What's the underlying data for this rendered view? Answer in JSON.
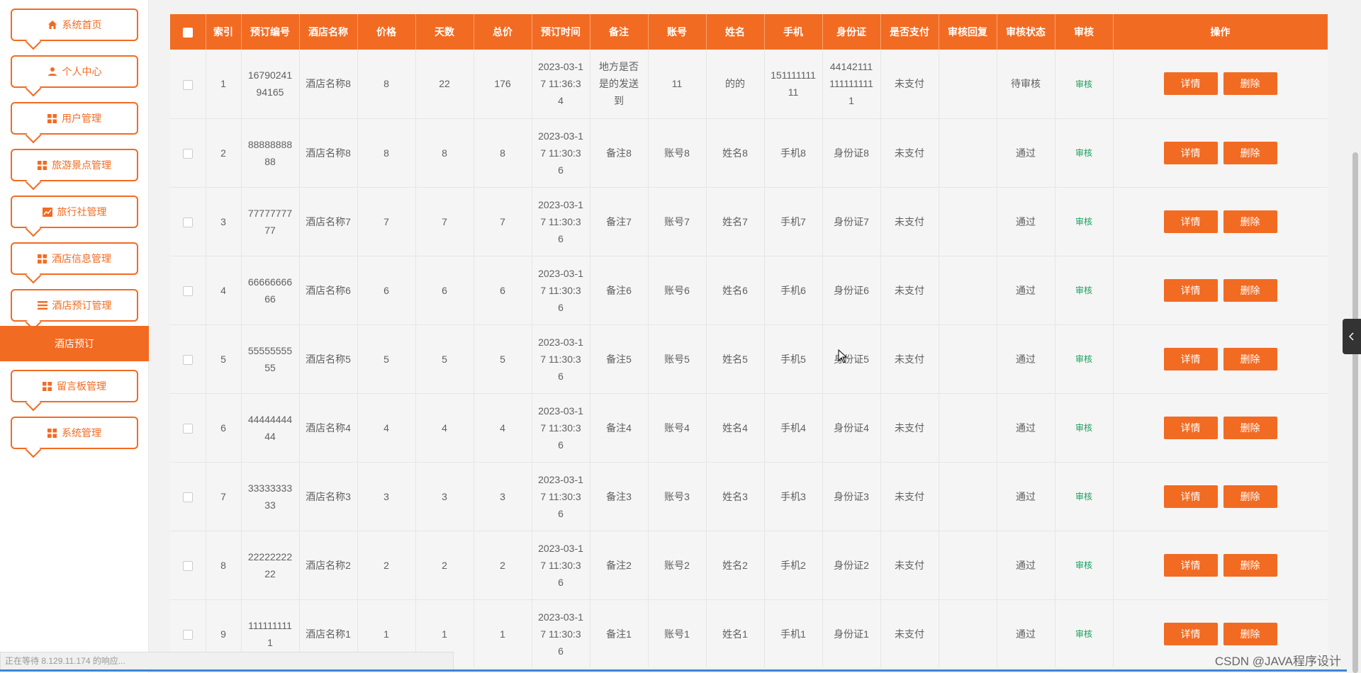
{
  "sidebar": {
    "items": [
      {
        "label": "系统首页",
        "icon": "home-icon"
      },
      {
        "label": "个人中心",
        "icon": "user-icon"
      },
      {
        "label": "用户管理",
        "icon": "grid-icon"
      },
      {
        "label": "旅游景点管理",
        "icon": "grid-icon"
      },
      {
        "label": "旅行社管理",
        "icon": "chart-icon"
      },
      {
        "label": "酒店信息管理",
        "icon": "grid-icon"
      },
      {
        "label": "酒店预订管理",
        "icon": "list-icon"
      },
      {
        "label": "留言板管理",
        "icon": "grid-icon"
      },
      {
        "label": "系统管理",
        "icon": "grid-icon"
      }
    ],
    "active_sub": "酒店预订"
  },
  "table": {
    "headers": [
      "",
      "索引",
      "预订编号",
      "酒店名称",
      "价格",
      "天数",
      "总价",
      "预订时间",
      "备注",
      "账号",
      "姓名",
      "手机",
      "身份证",
      "是否支付",
      "审核回复",
      "审核状态",
      "审核",
      "操作"
    ],
    "audit_label": "审核",
    "detail_label": "详情",
    "delete_label": "删除",
    "rows": [
      [
        "1",
        "1679024194165",
        "酒店名称8",
        "8",
        "22",
        "176",
        "2023-03-17 11:36:34",
        "地方是否是的发送到",
        "11",
        "的的",
        "15111111111",
        "441421111111111111",
        "未支付",
        "",
        "待审核"
      ],
      [
        "2",
        "8888888888",
        "酒店名称8",
        "8",
        "8",
        "8",
        "2023-03-17 11:30:36",
        "备注8",
        "账号8",
        "姓名8",
        "手机8",
        "身份证8",
        "未支付",
        "",
        "通过"
      ],
      [
        "3",
        "7777777777",
        "酒店名称7",
        "7",
        "7",
        "7",
        "2023-03-17 11:30:36",
        "备注7",
        "账号7",
        "姓名7",
        "手机7",
        "身份证7",
        "未支付",
        "",
        "通过"
      ],
      [
        "4",
        "6666666666",
        "酒店名称6",
        "6",
        "6",
        "6",
        "2023-03-17 11:30:36",
        "备注6",
        "账号6",
        "姓名6",
        "手机6",
        "身份证6",
        "未支付",
        "",
        "通过"
      ],
      [
        "5",
        "5555555555",
        "酒店名称5",
        "5",
        "5",
        "5",
        "2023-03-17 11:30:36",
        "备注5",
        "账号5",
        "姓名5",
        "手机5",
        "身份证5",
        "未支付",
        "",
        "通过"
      ],
      [
        "6",
        "4444444444",
        "酒店名称4",
        "4",
        "4",
        "4",
        "2023-03-17 11:30:36",
        "备注4",
        "账号4",
        "姓名4",
        "手机4",
        "身份证4",
        "未支付",
        "",
        "通过"
      ],
      [
        "7",
        "3333333333",
        "酒店名称3",
        "3",
        "3",
        "3",
        "2023-03-17 11:30:36",
        "备注3",
        "账号3",
        "姓名3",
        "手机3",
        "身份证3",
        "未支付",
        "",
        "通过"
      ],
      [
        "8",
        "2222222222",
        "酒店名称2",
        "2",
        "2",
        "2",
        "2023-03-17 11:30:36",
        "备注2",
        "账号2",
        "姓名2",
        "手机2",
        "身份证2",
        "未支付",
        "",
        "通过"
      ],
      [
        "9",
        "1111111111",
        "酒店名称1",
        "1",
        "1",
        "1",
        "2023-03-17 11:30:36",
        "备注1",
        "账号1",
        "姓名1",
        "手机1",
        "身份证1",
        "未支付",
        "",
        "通过"
      ]
    ]
  },
  "status_bar": {
    "text": "正在等待 8.129.11.174 的响应..."
  },
  "watermark": "CSDN @JAVA程序设计",
  "colors": {
    "accent": "#f26b22",
    "audit_link": "#17a05d"
  }
}
